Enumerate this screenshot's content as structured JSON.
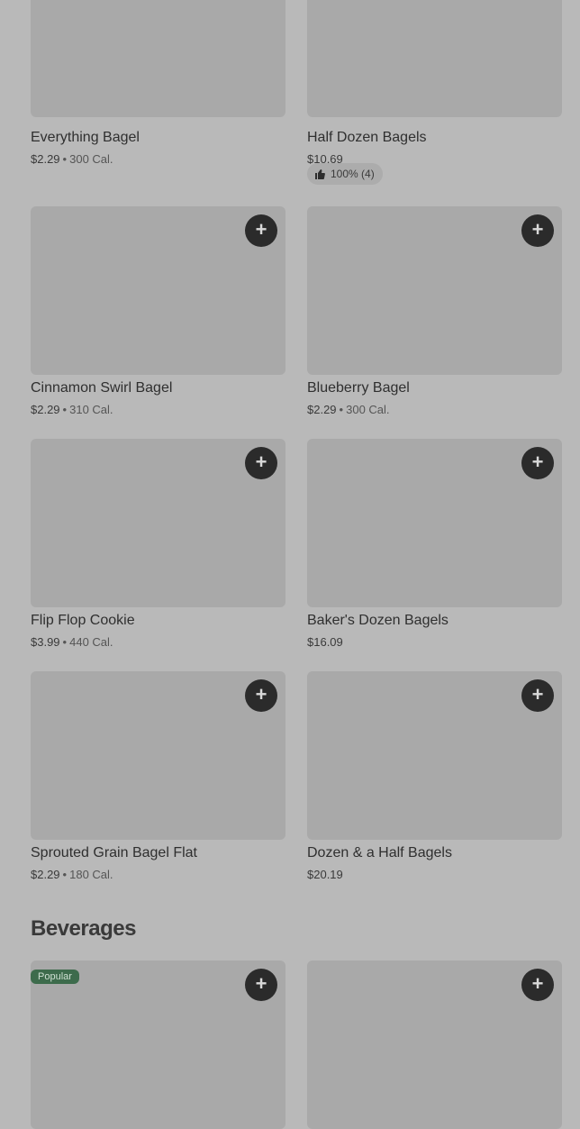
{
  "items": [
    {
      "name": "Everything Bagel",
      "price": "$2.29",
      "calories": "300 Cal."
    },
    {
      "name": "Half Dozen Bagels",
      "price": "$10.69",
      "rating": "100% (4)"
    },
    {
      "name": "Cinnamon Swirl Bagel",
      "price": "$2.29",
      "calories": "310 Cal."
    },
    {
      "name": "Blueberry Bagel",
      "price": "$2.29",
      "calories": "300 Cal."
    },
    {
      "name": "Flip Flop Cookie",
      "price": "$3.99",
      "calories": "440 Cal."
    },
    {
      "name": "Baker's Dozen Bagels",
      "price": "$16.09"
    },
    {
      "name": "Sprouted Grain Bagel Flat",
      "price": "$2.29",
      "calories": "180 Cal."
    },
    {
      "name": "Dozen & a Half Bagels",
      "price": "$20.19"
    }
  ],
  "section": {
    "title": "Beverages",
    "badge": "Popular"
  },
  "separator": "•",
  "add_symbol": "+",
  "icons": {
    "add": "plus-icon",
    "rating": "thumbs-up-icon"
  },
  "colors": {
    "background": "#b9b9b9",
    "image_placeholder": "#a9a9a9",
    "add_button": "#2b2b2b",
    "badge": "#3d6b4c"
  }
}
